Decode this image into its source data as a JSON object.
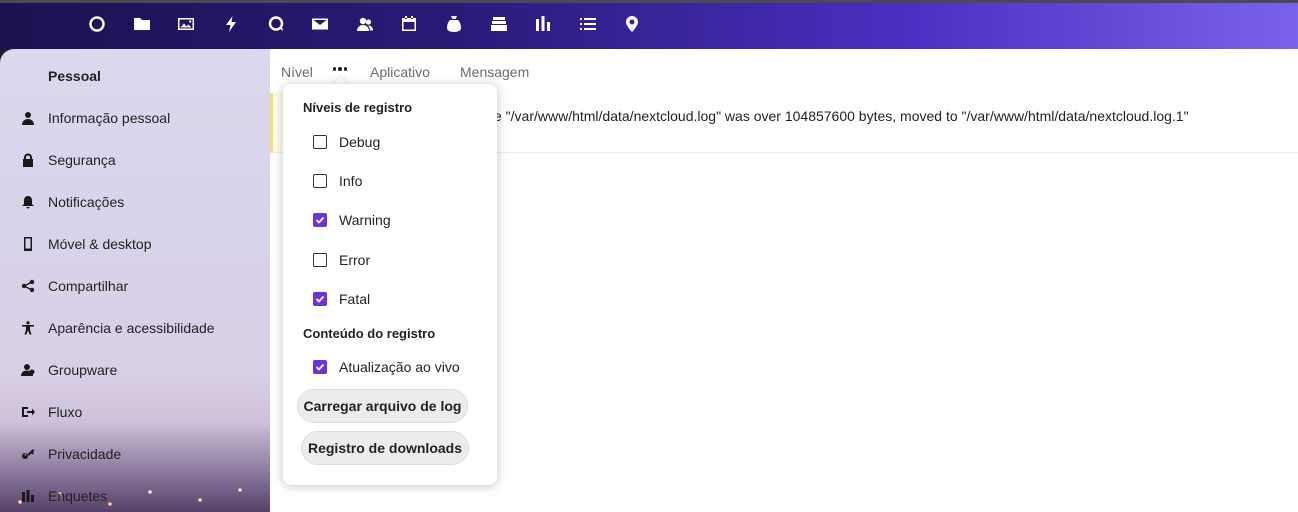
{
  "topbar": {
    "apps": [
      {
        "icon": "circle-icon"
      },
      {
        "icon": "folder-icon"
      },
      {
        "icon": "image-icon"
      },
      {
        "icon": "lightning-icon"
      },
      {
        "icon": "chat-icon"
      },
      {
        "icon": "mail-icon"
      },
      {
        "icon": "contacts-icon"
      },
      {
        "icon": "calendar-icon"
      },
      {
        "icon": "money-bag-icon"
      },
      {
        "icon": "deck-icon"
      },
      {
        "icon": "bar-chart-icon"
      },
      {
        "icon": "list-icon"
      },
      {
        "icon": "map-pin-icon"
      }
    ]
  },
  "sidebar": {
    "title": "Pessoal",
    "items": [
      {
        "label": "Informação pessoal",
        "icon": "user-icon"
      },
      {
        "label": "Segurança",
        "icon": "lock-icon"
      },
      {
        "label": "Notificações",
        "icon": "bell-icon"
      },
      {
        "label": "Móvel & desktop",
        "icon": "phone-icon"
      },
      {
        "label": "Compartilhar",
        "icon": "share-icon"
      },
      {
        "label": "Aparência e acessibilidade",
        "icon": "accessibility-icon"
      },
      {
        "label": "Groupware",
        "icon": "groupware-icon"
      },
      {
        "label": "Fluxo",
        "icon": "flow-icon"
      },
      {
        "label": "Privacidade",
        "icon": "key-icon"
      },
      {
        "label": "Enquetes",
        "icon": "poll-icon"
      }
    ]
  },
  "table": {
    "columns": {
      "level": "Nível",
      "app": "Aplicativo",
      "message": "Mensagem"
    },
    "row_message": "e \"/var/www/html/data/nextcloud.log\" was over 104857600 bytes, moved to \"/var/www/html/data/nextcloud.log.1\""
  },
  "popover": {
    "levels_heading": "Níveis de registro",
    "levels": [
      {
        "label": "Debug",
        "checked": false
      },
      {
        "label": "Info",
        "checked": false
      },
      {
        "label": "Warning",
        "checked": true
      },
      {
        "label": "Error",
        "checked": false
      },
      {
        "label": "Fatal",
        "checked": true
      }
    ],
    "content_heading": "Conteúdo do registro",
    "live": {
      "label": "Atualização ao vivo",
      "checked": true
    },
    "load_button": "Carregar arquivo de log",
    "download_button": "Registro de downloads"
  },
  "colors": {
    "accent": "#6a35d8",
    "warning_row": "#f5dc7a"
  }
}
